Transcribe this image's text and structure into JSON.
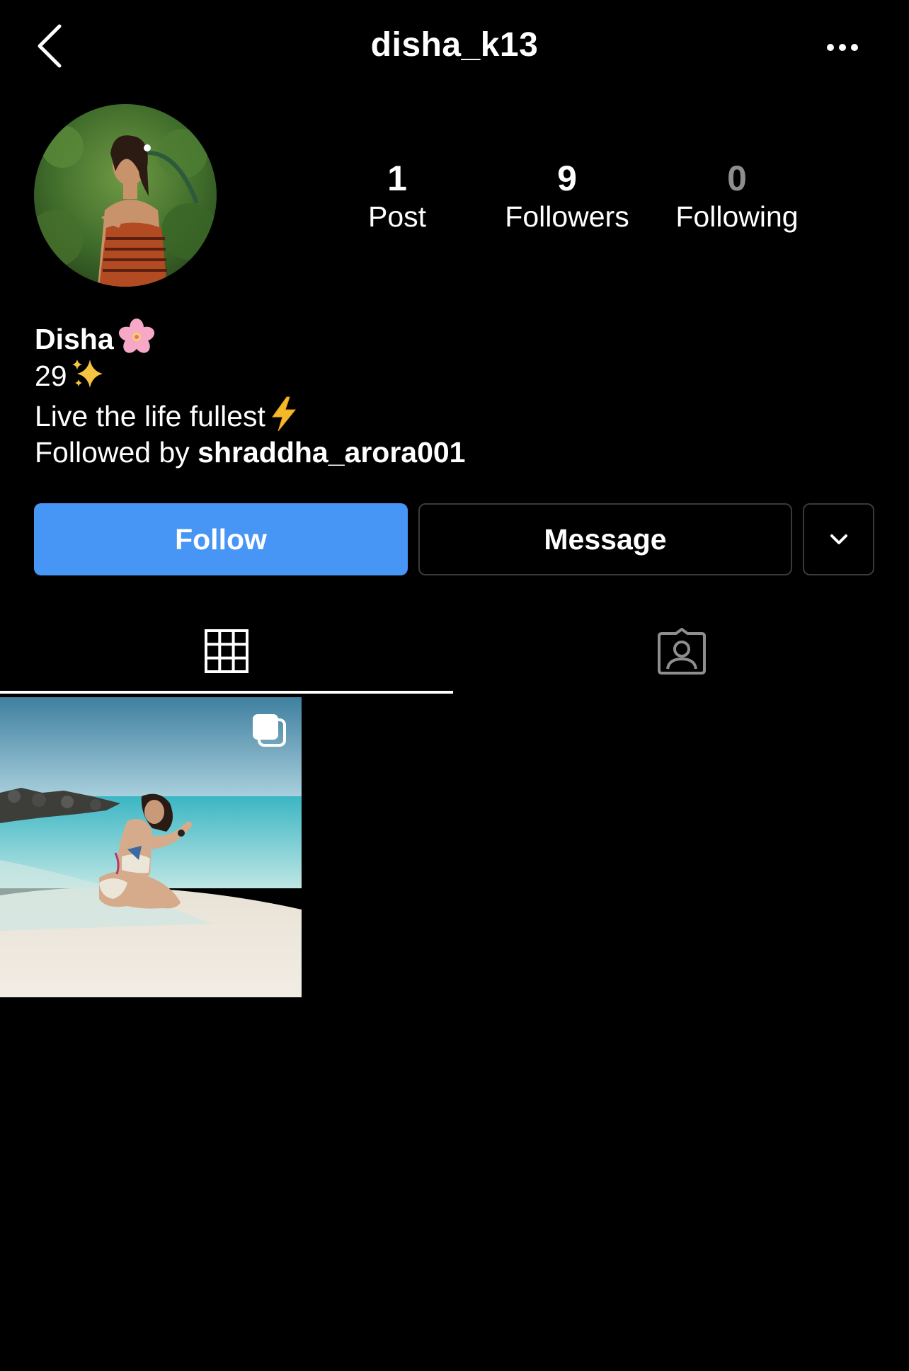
{
  "header": {
    "username": "disha_k13",
    "back_icon": "chevron-left-icon",
    "more_icon": "more-horizontal-icon"
  },
  "stats": [
    {
      "count": "1",
      "label": "Post"
    },
    {
      "count": "9",
      "label": "Followers"
    },
    {
      "count": "0",
      "label": "Following"
    }
  ],
  "bio": {
    "name": "Disha",
    "name_emoji": "cherry-blossom",
    "age": "29",
    "age_emoji": "sparkles",
    "text": "Live the life fullest",
    "text_emoji": "high-voltage",
    "followed_prefix": "Followed by ",
    "followed_user": "shraddha_arora001"
  },
  "actions": {
    "follow_label": "Follow",
    "message_label": "Message",
    "dropdown_icon": "chevron-down-icon"
  },
  "tabs": [
    {
      "icon": "grid-icon",
      "active": true
    },
    {
      "icon": "tagged-person-icon",
      "active": false
    }
  ],
  "posts": [
    {
      "type": "carousel",
      "icon": "multiple-images-icon"
    }
  ],
  "colors": {
    "background": "#000000",
    "follow_button": "#4795f5",
    "outline_border": "#3a3a3a",
    "muted_text": "#8e8e8e"
  }
}
